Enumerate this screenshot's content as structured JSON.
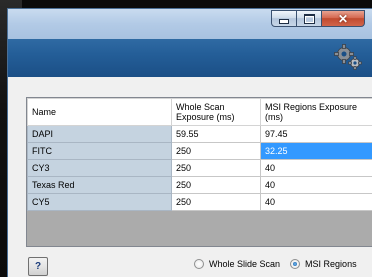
{
  "grid": {
    "columns": [
      "Name",
      "Whole Scan\nExposure (ms)",
      "MSI Regions Exposure\n(ms)"
    ],
    "rows": [
      {
        "name": "DAPI",
        "whole": "59.55",
        "msi": "97.45"
      },
      {
        "name": "FITC",
        "whole": "250",
        "msi": "32.25"
      },
      {
        "name": "CY3",
        "whole": "250",
        "msi": "40"
      },
      {
        "name": "Texas Red",
        "whole": "250",
        "msi": "40"
      },
      {
        "name": "CY5",
        "whole": "250",
        "msi": "40"
      }
    ]
  },
  "help_label": "?",
  "mode_options": [
    {
      "label": "Whole Slide Scan",
      "checked": false
    },
    {
      "label": "MSI Regions",
      "checked": true
    }
  ],
  "colors": {
    "banner": "#245e98",
    "selection": "#3399ff",
    "name_column": "#c5d3e0"
  },
  "icons": {
    "minimize": "minimize-icon",
    "maximize": "maximize-icon",
    "close": "close-icon",
    "settings": "gears-icon",
    "help": "help-icon"
  }
}
